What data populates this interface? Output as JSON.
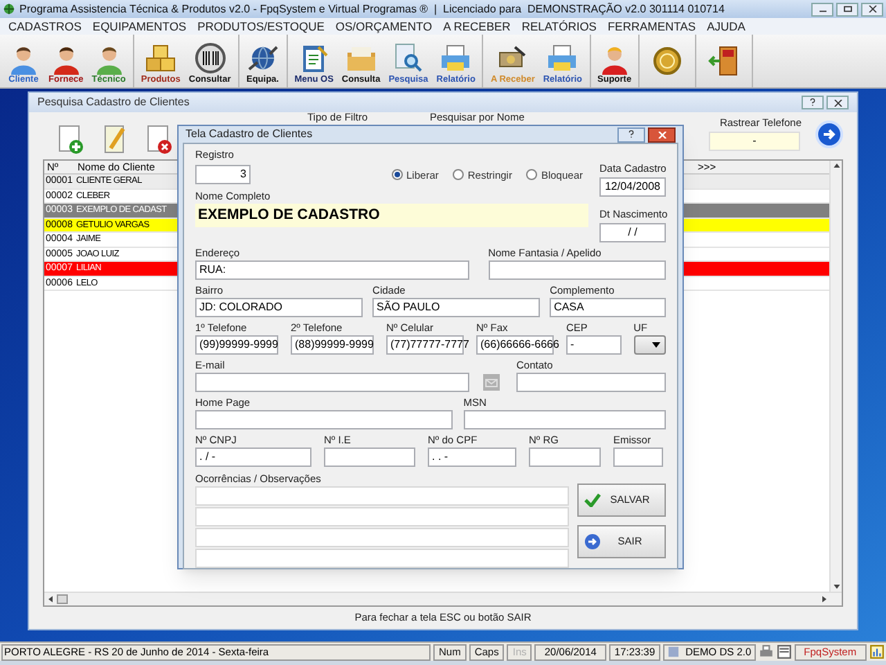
{
  "window": {
    "title": "Programa Assistencia Técnica & Produtos v2.0 - FpqSystem e Virtual Programas ®  |  Licenciado para  DEMONSTRAÇÃO v2.0 301114 010714"
  },
  "menu": [
    "CADASTROS",
    "EQUIPAMENTOS",
    "PRODUTOS/ESTOQUE",
    "OS/ORÇAMENTO",
    "A RECEBER",
    "RELATÓRIOS",
    "FERRAMENTAS",
    "AJUDA"
  ],
  "toolbar": {
    "groups": [
      {
        "tools": [
          {
            "kind": "labeled",
            "label": "Cliente",
            "color": "#2a62c4"
          },
          {
            "kind": "labeled",
            "label": "Fornece",
            "color": "#a01818"
          },
          {
            "kind": "labeled",
            "label": "Técnico",
            "color": "#2a7a2a"
          }
        ]
      },
      {
        "tools": [
          {
            "kind": "labeled",
            "label": "Produtos",
            "color": "#a02a1a"
          },
          {
            "kind": "labeled",
            "label": "Consultar",
            "color": "#111111"
          }
        ]
      },
      {
        "tools": [
          {
            "kind": "labeled",
            "label": "Equipa.",
            "color": "#111111"
          }
        ]
      },
      {
        "tools": [
          {
            "kind": "labeled",
            "label": "Menu OS",
            "color": "#1a2a6a"
          },
          {
            "kind": "labeled",
            "label": "Consulta",
            "color": "#111111"
          },
          {
            "kind": "labeled",
            "label": "Pesquisa",
            "color": "#2a52b0"
          },
          {
            "kind": "labeled",
            "label": "Relatório",
            "color": "#2a52b0"
          }
        ]
      },
      {
        "tools": [
          {
            "kind": "labeled",
            "label": "A Receber",
            "color": "#d08a2a"
          },
          {
            "kind": "labeled",
            "label": "Relatório",
            "color": "#2a52b0"
          }
        ]
      },
      {
        "tools": [
          {
            "kind": "labeled",
            "label": "Suporte",
            "color": "#111111"
          }
        ]
      },
      {
        "tools": [
          {
            "kind": "icon"
          }
        ]
      },
      {
        "tools": [
          {
            "kind": "icon"
          }
        ]
      }
    ]
  },
  "search_window": {
    "title": "Pesquisa Cadastro de Clientes",
    "filter_label": "Tipo de Filtro",
    "search_label": "Pesquisar por Nome",
    "phone_search": {
      "label": "Rastrear Telefone",
      "value": "-"
    },
    "table": {
      "columns": [
        "Nº",
        "Nome do Cliente",
        ">>>"
      ],
      "rows": [
        {
          "number": "00001",
          "name": "CLIENTE GERAL",
          "color": "#ececec"
        },
        {
          "number": "00002",
          "name": "CLEBER",
          "color": "#ffffff"
        },
        {
          "number": "00003",
          "name": "EXEMPLO DE CADAST",
          "color": "#808080"
        },
        {
          "number": "00008",
          "name": "GETULIO VARGAS",
          "color": "#ffff00"
        },
        {
          "number": "00004",
          "name": "JAIME",
          "color": "#ffffff"
        },
        {
          "number": "00005",
          "name": "JOAO LUIZ",
          "color": "#ffffff"
        },
        {
          "number": "00007",
          "name": "LILIAN",
          "color": "#ff0000"
        },
        {
          "number": "00006",
          "name": "LELO",
          "color": "#ffffff"
        }
      ]
    },
    "footer": "Para fechar a tela ESC ou botão SAIR"
  },
  "dialog": {
    "title": "Tela Cadastro de Clientes",
    "registro": {
      "label": "Registro",
      "value": "3"
    },
    "access": [
      {
        "label": "Liberar",
        "selected": true
      },
      {
        "label": "Restringir",
        "selected": false
      },
      {
        "label": "Bloquear",
        "selected": false
      }
    ],
    "data_cadastro": {
      "label": "Data Cadastro",
      "value": "12/04/2008"
    },
    "nome": {
      "label": "Nome Completo",
      "value": "EXEMPLO DE CADASTRO"
    },
    "dt_nascimento": {
      "label": "Dt Nascimento",
      "value": "/ /"
    },
    "fields": [
      {
        "kind": "text",
        "label": "Endereço",
        "value": "RUA:"
      },
      {
        "kind": "text",
        "label": "Nome Fantasia / Apelido"
      },
      {
        "kind": "text",
        "label": "Bairro",
        "value": "JD: COLORADO"
      },
      {
        "kind": "text",
        "label": "Cidade",
        "value": "SÃO PAULO"
      },
      {
        "kind": "text",
        "label": "Complemento",
        "value": "CASA"
      },
      {
        "kind": "text",
        "label": "1º Telefone",
        "value": "(99)99999-9999"
      },
      {
        "kind": "text",
        "label": "2º Telefone",
        "value": "(88)99999-9999"
      },
      {
        "kind": "text",
        "label": "Nº Celular",
        "value": "(77)77777-7777"
      },
      {
        "kind": "text",
        "label": "Nº Fax",
        "value": "(66)66666-6666"
      },
      {
        "kind": "text",
        "label": "CEP",
        "value": "-"
      },
      {
        "kind": "select",
        "label": "UF"
      },
      {
        "kind": "mail",
        "label": "E-mail"
      },
      {
        "kind": "text",
        "label": "Contato"
      },
      {
        "kind": "text",
        "label": "Home Page"
      },
      {
        "kind": "text",
        "label": "MSN"
      },
      {
        "kind": "text",
        "label": "Nº CNPJ",
        "value": ". / -"
      },
      {
        "kind": "text",
        "label": "Nº I.E"
      },
      {
        "kind": "text",
        "label": "Nº do CPF",
        "value": ". . -"
      },
      {
        "kind": "text",
        "label": "Nº RG"
      },
      {
        "kind": "text",
        "label": "Emissor"
      }
    ],
    "notes": {
      "label": "Ocorrências / Observações"
    },
    "buttons": [
      {
        "label": "SALVAR"
      },
      {
        "label": "SAIR"
      }
    ]
  },
  "status_bar": {
    "location": "PORTO ALEGRE - RS 20 de Junho de 2014 - Sexta-feira",
    "keys": [
      {
        "label": "Num",
        "disabled": false
      },
      {
        "label": "Caps",
        "disabled": false
      },
      {
        "label": "Ins",
        "disabled": true
      }
    ],
    "date": "20/06/2014",
    "time": "17:23:39",
    "version": "DEMO DS 2.0",
    "brand": "FpqSystem"
  }
}
